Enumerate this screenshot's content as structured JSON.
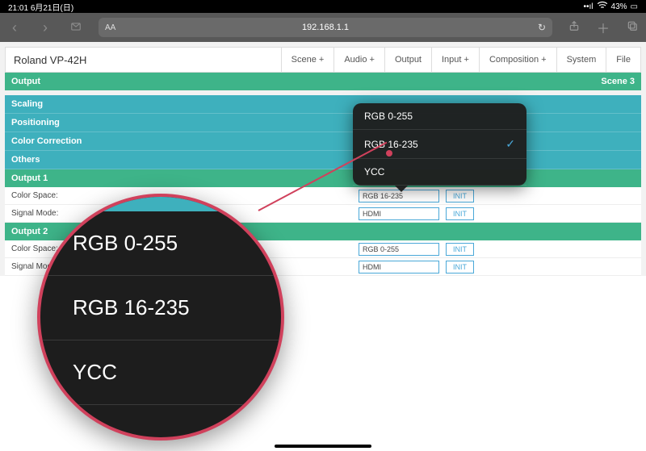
{
  "status": {
    "time": "21:01",
    "date": "6月21日(日)",
    "battery": "43%"
  },
  "browser": {
    "url": "192.168.1.1",
    "aa": "AA"
  },
  "header": {
    "title": "Roland VP-42H",
    "tabs": [
      "Scene +",
      "Audio +",
      "Output",
      "Input +",
      "Composition +",
      "System",
      "File"
    ]
  },
  "section": {
    "title": "Output",
    "scene": "Scene 3"
  },
  "categories": [
    "Scaling",
    "Positioning",
    "Color Correction",
    "Others"
  ],
  "outputs": [
    {
      "title": "Output 1",
      "rows": [
        {
          "label": "Color Space:",
          "value": "RGB 16-235",
          "btn": "INIT"
        },
        {
          "label": "Signal Mode:",
          "value": "HDMI",
          "btn": "INIT"
        }
      ]
    },
    {
      "title": "Output 2",
      "rows": [
        {
          "label": "Color Space:",
          "value": "RGB 0-255",
          "btn": "INIT"
        },
        {
          "label": "Signal Mode:",
          "value": "HDMI",
          "btn": "INIT"
        }
      ]
    }
  ],
  "popover": {
    "items": [
      "RGB 0-255",
      "RGB 16-235",
      "YCC"
    ],
    "selected": 1
  },
  "magnifier": {
    "items": [
      "RGB 0-255",
      "RGB 16-235",
      "YCC"
    ]
  }
}
